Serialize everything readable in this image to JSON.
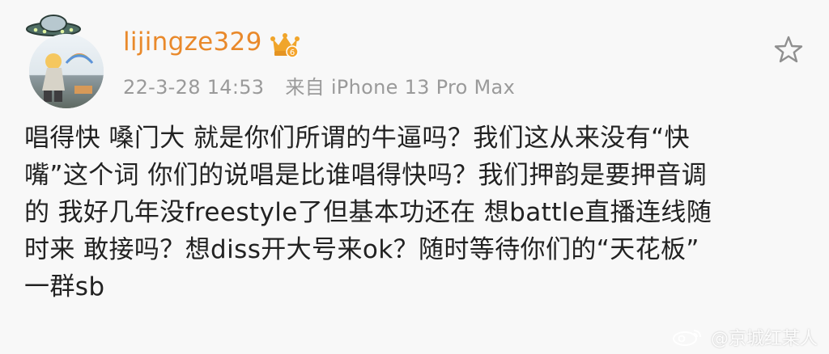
{
  "post": {
    "username": "lijingze329",
    "badge_level": "6",
    "date": "22-3-28 14:53",
    "source": "来自 iPhone 13 Pro Max",
    "lines": [
      "唱得快 嗓门大 就是你们所谓的牛逼吗？我们这从来没有“快",
      "嘴”这个词 你们的说唱是比谁唱得快吗？我们押韵是要押音调",
      "的 我好几年没freestyle了但基本功还在 想battle直播连线随",
      "时来 敢接吗？想diss开大号来ok？随时等待你们的“天花板”",
      "一群sb"
    ]
  },
  "watermark": {
    "text": "@京城红某人"
  },
  "icons": {
    "avatar": "user-avatar",
    "crown": "vip-crown-icon",
    "star": "favorite-star-icon",
    "weibo": "weibo-logo-icon",
    "ufo": "ufo-decoration-icon"
  },
  "colors": {
    "username": "#e9892b",
    "meta": "#9a9a9a",
    "text": "#222222",
    "background": "#f8f8f8"
  }
}
